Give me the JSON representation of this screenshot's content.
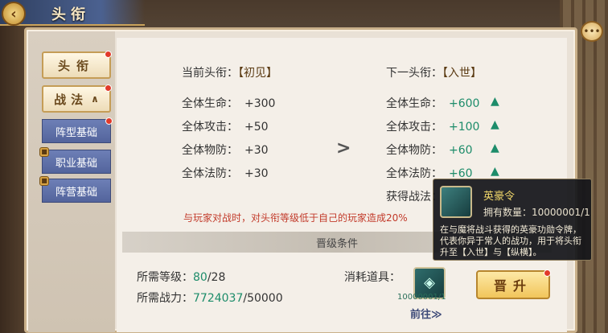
{
  "header": {
    "title": "头衔",
    "back_icon": "back-arrow-icon",
    "chat_icon": "chat-bubble-icon"
  },
  "sidebar": {
    "tabs": [
      {
        "label": "头衔",
        "active": true,
        "has_dot": true
      },
      {
        "label": "战法",
        "active": true,
        "has_dot": true,
        "expanded": true
      }
    ],
    "subtabs": [
      {
        "label": "阵型基础",
        "locked": false,
        "has_dot": true
      },
      {
        "label": "职业基础",
        "locked": true
      },
      {
        "label": "阵营基础",
        "locked": true
      }
    ]
  },
  "current": {
    "heading": "当前头衔：",
    "title": "【初见】",
    "stats": [
      {
        "label": "全体生命：",
        "value": "+300"
      },
      {
        "label": "全体攻击：",
        "value": "+50"
      },
      {
        "label": "全体物防：",
        "value": "+30"
      },
      {
        "label": "全体法防：",
        "value": "+30"
      }
    ]
  },
  "next": {
    "heading": "下一头衔：",
    "title": "【入世】",
    "stats": [
      {
        "label": "全体生命：",
        "value": "+600"
      },
      {
        "label": "全体攻击：",
        "value": "+100"
      },
      {
        "label": "全体物防：",
        "value": "+60"
      },
      {
        "label": "全体法防：",
        "value": "+60"
      }
    ],
    "extra_label": "获得战法："
  },
  "compare_arrow": ">",
  "warning": "与玩家对战时，对头衔等级低于自己的玩家造成20%",
  "conditions": {
    "heading": "晋级条件",
    "level_label": "所需等级：",
    "level_current": "80",
    "level_sep": "/",
    "level_required": "28",
    "power_label": "所需战力：",
    "power_current": "7724037",
    "power_sep": "/",
    "power_required": "50000",
    "consume_label": "消耗道具：",
    "item_count": "10000001/1",
    "goto_label": "前往",
    "upgrade_label": "晋升"
  },
  "tooltip": {
    "name": "英豪令",
    "count_label": "拥有数量：",
    "count_value": "10000001/1",
    "description": "在与魔将战斗获得的英豪功勋令牌，代表你异于常人的战功，用于将头衔升至【入世】与【纵横】。"
  },
  "colors": {
    "accent_green": "#1d8c6a",
    "warning_red": "#c23a2a",
    "tab_blue": "#53649c"
  }
}
